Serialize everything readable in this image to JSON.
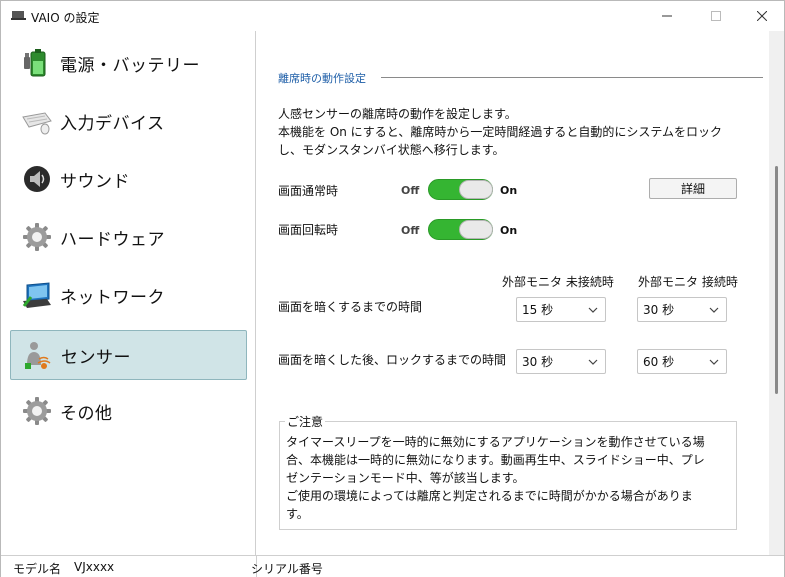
{
  "window": {
    "title": "VAIO の設定"
  },
  "sidebar": {
    "items": [
      {
        "label": "電源・バッテリー",
        "icon": "battery-icon",
        "active": false
      },
      {
        "label": "入力デバイス",
        "icon": "keyboard-icon",
        "active": false
      },
      {
        "label": "サウンド",
        "icon": "speaker-icon",
        "active": false
      },
      {
        "label": "ハードウェア",
        "icon": "gear-icon",
        "active": false
      },
      {
        "label": "ネットワーク",
        "icon": "network-icon",
        "active": false
      },
      {
        "label": "センサー",
        "icon": "sensor-icon",
        "active": true
      },
      {
        "label": "その他",
        "icon": "gear-icon",
        "active": false
      }
    ]
  },
  "main": {
    "section_title": "離席時の動作設定",
    "description": [
      "人感センサーの離席時の動作を設定します。",
      "本機能を On にすると、離席時から一定時間経過すると自動的にシステムをロック",
      "し、モダンスタンバイ状態へ移行します。"
    ],
    "normal": {
      "label": "画面通常時",
      "off": "Off",
      "on": "On",
      "state": "on"
    },
    "rotated": {
      "label": "画面回転時",
      "off": "Off",
      "on": "On",
      "state": "on"
    },
    "detail_button": "詳細",
    "columns": {
      "disconnected": "外部モニタ 未接続時",
      "connected": "外部モニタ 接続時"
    },
    "dim_row": {
      "label": "画面を暗くするまでの時間",
      "disconnected_value": "15 秒",
      "connected_value": "30 秒"
    },
    "lock_row": {
      "label": "画面を暗くした後、ロックするまでの時間",
      "disconnected_value": "30 秒",
      "connected_value": "60 秒"
    },
    "notice": {
      "title": "ご注意",
      "lines": [
        "タイマースリープを一時的に無効にするアプリケーションを動作させている場",
        "合、本機能は一時的に無効になります。動画再生中、スライドショー中、プレ",
        "ゼンテーションモード中、等が該当します。",
        "ご使用の環境によっては離席と判定されるまでに時間がかかる場合がありま",
        "す。"
      ]
    }
  },
  "status": {
    "model_label": "モデル名",
    "model_value": "VJxxxx",
    "serial_label": "シリアル番号"
  },
  "colors": {
    "accent": "#1f5fa8",
    "toggle_on": "#35b532",
    "active_nav": "#d0e4e7"
  }
}
